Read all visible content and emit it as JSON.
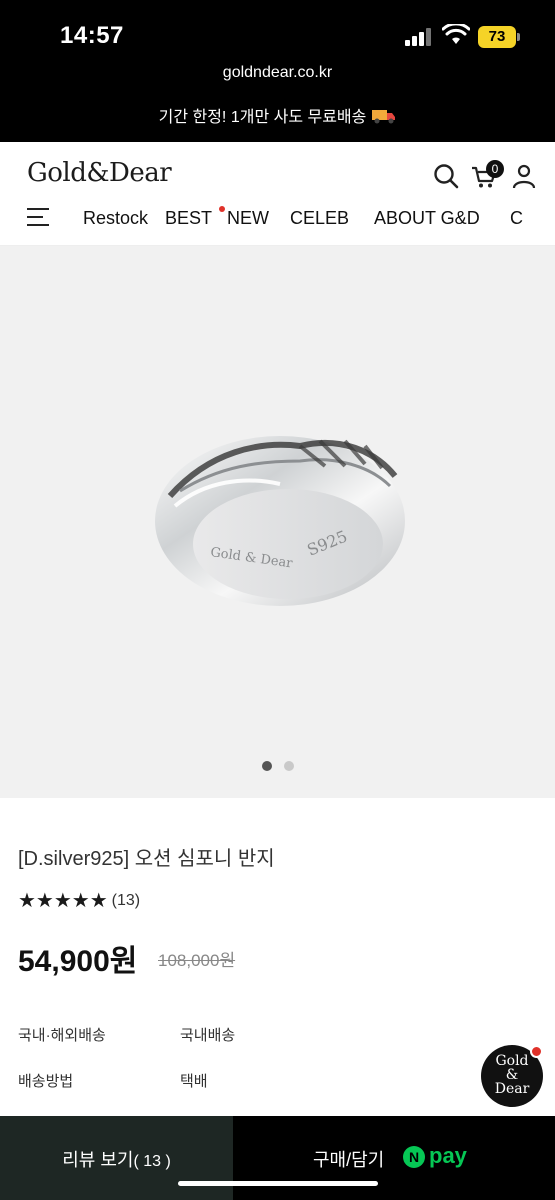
{
  "status": {
    "time": "14:57",
    "battery": "73"
  },
  "browser": {
    "url": "goldndear.co.kr"
  },
  "promo": {
    "text": "기간 한정! 1개만 사도 무료배송"
  },
  "header": {
    "logo": "Gold&Dear",
    "cart_count": "0",
    "nav": [
      "Restock",
      "BEST",
      "NEW",
      "CELEB",
      "ABOUT G&D",
      "C"
    ]
  },
  "hero": {
    "engraving": [
      "Gold & Dear",
      "S925"
    ]
  },
  "product": {
    "title": "[D.silver925] 오션 심포니 반지",
    "rating": 5,
    "stars": "★★★★★",
    "review_count": "(13)",
    "price": "54,900원",
    "original_price": "108,000원",
    "shipping": [
      {
        "label": "국내·해외배송",
        "value": "국내배송"
      },
      {
        "label": "배송방법",
        "value": "택배"
      }
    ]
  },
  "chat_badge": {
    "line1": "Gold",
    "line2": "&",
    "line3": "Dear"
  },
  "bottom": {
    "review_label": "리뷰 보기",
    "review_count": "( 13 )",
    "buy_label": "구매/담기",
    "npay_n": "N",
    "npay_text": "pay"
  },
  "colors": {
    "npay_green": "#06c755",
    "review_bg": "#1e2724",
    "badge_red": "#e0322a"
  }
}
